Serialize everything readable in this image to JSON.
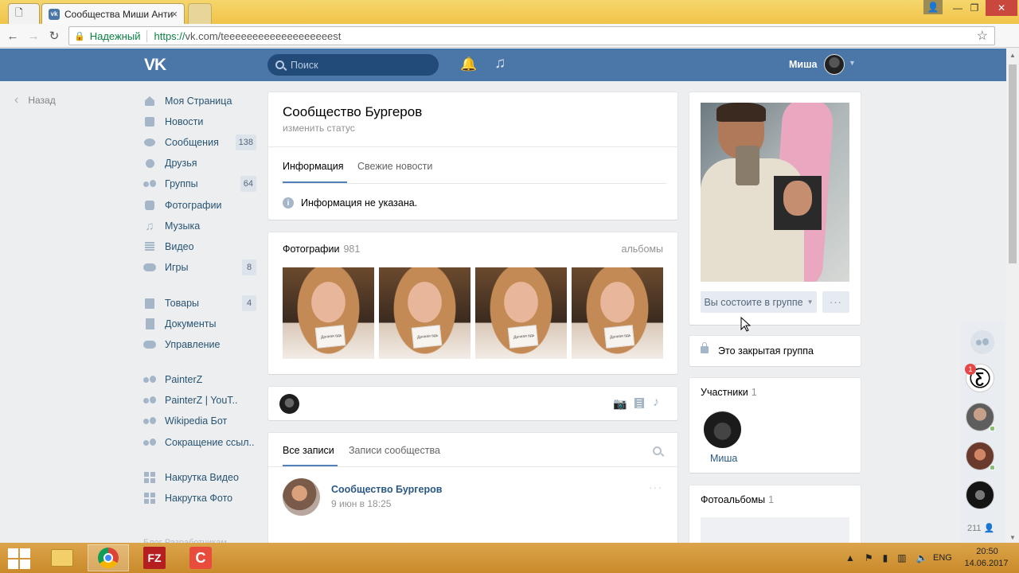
{
  "browser": {
    "active_tab_title": "Сообщества Миши Анти",
    "tab_close_glyph": "×",
    "secure_label": "Надежный",
    "url_scheme": "https://",
    "url_rest": "vk.com/teeeeeeeeeeeeeeeeeeest"
  },
  "header": {
    "logo": "VK",
    "search_placeholder": "Поиск",
    "user_name": "Миша"
  },
  "back_link": "Назад",
  "left_menu": {
    "items": [
      {
        "label": "Моя Страница",
        "icon": "home-icon"
      },
      {
        "label": "Новости",
        "icon": "news-icon"
      },
      {
        "label": "Сообщения",
        "icon": "messages-icon",
        "count": "138"
      },
      {
        "label": "Друзья",
        "icon": "friends-icon"
      },
      {
        "label": "Группы",
        "icon": "groups-icon",
        "count": "64"
      },
      {
        "label": "Фотографии",
        "icon": "camera-icon"
      },
      {
        "label": "Музыка",
        "icon": "music-icon"
      },
      {
        "label": "Видео",
        "icon": "video-icon"
      },
      {
        "label": "Игры",
        "icon": "gamepad-icon",
        "count": "8"
      },
      {
        "label": "Товары",
        "icon": "bag-icon",
        "count": "4"
      },
      {
        "label": "Документы",
        "icon": "document-icon"
      },
      {
        "label": "Управление",
        "icon": "gamepad-icon"
      },
      {
        "label": "PainterZ",
        "icon": "groups-icon"
      },
      {
        "label": "PainterZ | YouT..",
        "icon": "groups-icon"
      },
      {
        "label": "Wikipedia Бот",
        "icon": "groups-icon"
      },
      {
        "label": "Сокращение ссыл..",
        "icon": "groups-icon"
      },
      {
        "label": "Накрутка Видео",
        "icon": "apps-icon"
      },
      {
        "label": "Накрутка Фото",
        "icon": "apps-icon"
      }
    ],
    "footer_cut": "Блог  Разработчикам"
  },
  "group": {
    "title": "Сообщество Бургеров",
    "status": "изменить статус",
    "tabs": [
      "Информация",
      "Свежие новости"
    ],
    "info_text": "Информация не указана."
  },
  "photos": {
    "title": "Фотографии",
    "count": "981",
    "albums_link": "альбомы",
    "note_text": "Дачная вдь"
  },
  "wall": {
    "tabs": [
      "Все записи",
      "Записи сообщества"
    ],
    "post": {
      "author": "Сообщество Бургеров",
      "date": "9 июн в 18:25",
      "more": "···"
    }
  },
  "sidebar": {
    "member_button": "Вы состоите в группе",
    "more_button": "···",
    "closed_text": "Это закрытая группа",
    "members_title": "Участники",
    "members_count": "1",
    "member_name": "Миша",
    "albums_title": "Фотоальбомы",
    "albums_count": "1"
  },
  "chat": {
    "badge": "1",
    "online_count": "211"
  },
  "taskbar": {
    "lang": "ENG",
    "time": "20:50",
    "date": "14.06.2017",
    "filezilla_glyph": "FZ",
    "ccleaner_glyph": "C"
  },
  "colors": {
    "vk_blue": "#4a76a8",
    "link": "#2a5885",
    "taskbar": "#d89b38"
  }
}
